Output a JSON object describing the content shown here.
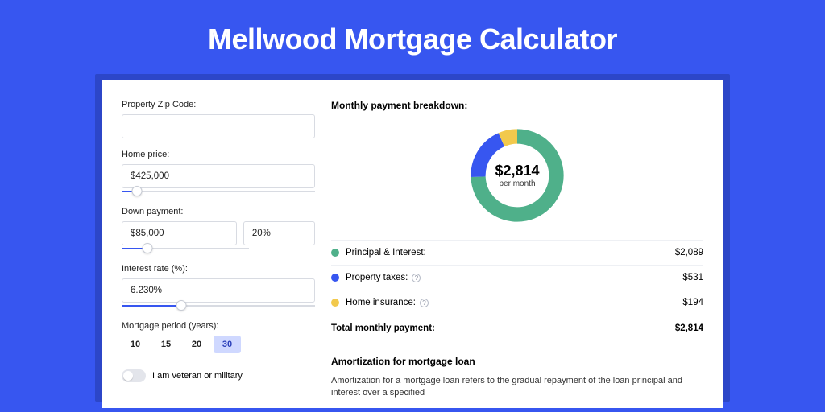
{
  "title": "Mellwood Mortgage Calculator",
  "form": {
    "zip": {
      "label": "Property Zip Code:",
      "value": ""
    },
    "home_price": {
      "label": "Home price:",
      "value": "$425,000",
      "slider_pct": 8
    },
    "down_payment": {
      "label": "Down payment:",
      "amount": "$85,000",
      "percent": "20%",
      "slider_pct": 20
    },
    "interest_rate": {
      "label": "Interest rate (%):",
      "value": "6.230%",
      "slider_pct": 31
    },
    "period": {
      "label": "Mortgage period (years):",
      "options": [
        "10",
        "15",
        "20",
        "30"
      ],
      "selected": "30"
    },
    "veteran": {
      "label": "I am veteran or military",
      "checked": false
    }
  },
  "breakdown": {
    "heading": "Monthly payment breakdown:",
    "center_amount": "$2,814",
    "center_sub": "per month",
    "items": [
      {
        "label": "Principal & Interest:",
        "value": "$2,089",
        "color": "#4fb08a",
        "pct": 74.3,
        "help": false
      },
      {
        "label": "Property taxes:",
        "value": "$531",
        "color": "#3756f0",
        "pct": 18.9,
        "help": true
      },
      {
        "label": "Home insurance:",
        "value": "$194",
        "color": "#f2c94c",
        "pct": 6.8,
        "help": true
      }
    ],
    "total_label": "Total monthly payment:",
    "total_value": "$2,814"
  },
  "amort": {
    "heading": "Amortization for mortgage loan",
    "text": "Amortization for a mortgage loan refers to the gradual repayment of the loan principal and interest over a specified"
  },
  "chart_data": {
    "type": "pie",
    "title": "Monthly payment breakdown",
    "series": [
      {
        "name": "Principal & Interest",
        "value": 2089,
        "color": "#4fb08a"
      },
      {
        "name": "Property taxes",
        "value": 531,
        "color": "#3756f0"
      },
      {
        "name": "Home insurance",
        "value": 194,
        "color": "#f2c94c"
      }
    ],
    "total": 2814,
    "center_label": "$2,814 per month"
  }
}
